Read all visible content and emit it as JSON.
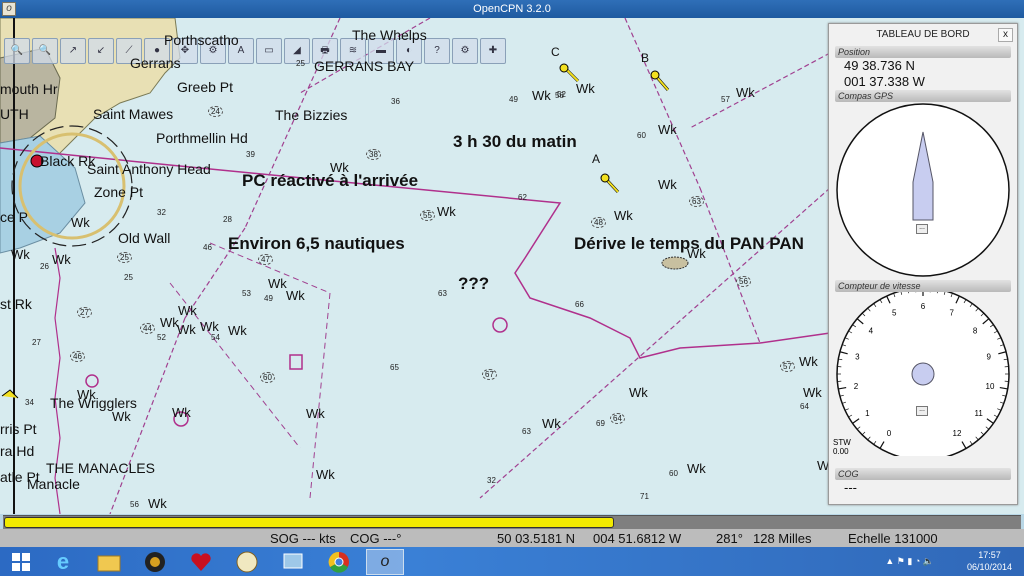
{
  "window": {
    "title": "OpenCPN 3.2.0",
    "app_glyph": "o"
  },
  "chart": {
    "places": [
      {
        "id": "porthscatho",
        "text": "Porthscatho"
      },
      {
        "id": "gerrans",
        "text": "Gerrans"
      },
      {
        "id": "gerrans-bay",
        "text": "GERRANS BAY"
      },
      {
        "id": "greeb-pt",
        "text": "Greeb Pt"
      },
      {
        "id": "mouth-hr",
        "text": "mouth Hr"
      },
      {
        "id": "uth",
        "text": "UTH"
      },
      {
        "id": "saint-mawes",
        "text": "Saint Mawes"
      },
      {
        "id": "the-bizzies",
        "text": "The Bizzies"
      },
      {
        "id": "porthmellin-hd",
        "text": "Porthmellin Hd"
      },
      {
        "id": "black-rk",
        "text": "Black Rk"
      },
      {
        "id": "saint-anthony-head",
        "text": "Saint Anthony Head"
      },
      {
        "id": "zone-pt",
        "text": "Zone Pt"
      },
      {
        "id": "ce-p",
        "text": "ce P"
      },
      {
        "id": "old-wall",
        "text": "Old Wall"
      },
      {
        "id": "st-rk",
        "text": "st Rk"
      },
      {
        "id": "the-whelps",
        "text": "The Whelps"
      },
      {
        "id": "the-wrigglers",
        "text": "The Wrigglers"
      },
      {
        "id": "rris-pt",
        "text": "rris Pt"
      },
      {
        "id": "ra-hd",
        "text": "ra Hd"
      },
      {
        "id": "the-manacles",
        "text": "THE MANACLES"
      },
      {
        "id": "atle-pt",
        "text": "atle Pt"
      },
      {
        "id": "manacle",
        "text": "Manacle"
      }
    ],
    "annotations": {
      "time": "3 h 30 du matin",
      "pc": "PC réactivé à l'arrivée",
      "distance": "Environ 6,5 nautiques",
      "question": "???",
      "drift": "Dérive le temps du PAN PAN"
    },
    "buoys": [
      "A",
      "B",
      "C"
    ],
    "wreck_label": "Wk",
    "wreck_count": 31,
    "depths": [
      "25",
      "24",
      "36",
      "39",
      "38",
      "49",
      "52",
      "55",
      "62",
      "58",
      "48",
      "25",
      "46",
      "47",
      "53",
      "49",
      "44",
      "52",
      "54",
      "60",
      "63",
      "65",
      "67",
      "66",
      "60",
      "64",
      "69",
      "63",
      "57",
      "60",
      "71",
      "46",
      "34",
      "56",
      "27",
      "28",
      "27",
      "25",
      "26",
      "32",
      "63",
      "57",
      "64",
      "56",
      "32"
    ]
  },
  "dashboard": {
    "title": "TABLEAU DE BORD",
    "close": "x",
    "position_header": "Position",
    "lat": "49 38.736 N",
    "lon": "001 37.338 W",
    "compass_header": "Compas GPS",
    "speed_header": "Compteur de vitesse",
    "speed_ticks": [
      "0",
      "1",
      "2",
      "3",
      "4",
      "5",
      "6",
      "7",
      "8",
      "9",
      "10",
      "11",
      "12"
    ],
    "stw_label": "STW",
    "stw_value": "0.00",
    "cog_header": "COG",
    "cog_value": "---",
    "dots_button": "..."
  },
  "progress": {
    "fraction": 0.6
  },
  "status": {
    "sog": "SOG --- kts",
    "cog": "COG ---°",
    "lat": "50 03.5181 N",
    "lon": "004 51.6812 W",
    "bearing": "281°",
    "distance": "128 Milles",
    "scale": "Echelle 131000"
  },
  "taskbar": {
    "time": "17:57",
    "date": "06/10/2014"
  },
  "colors": {
    "land": "#e8e0b4",
    "sea": "#d7ebef",
    "route": "#b0308c",
    "dashed": "#a04090",
    "progress": "#f2ea00"
  }
}
